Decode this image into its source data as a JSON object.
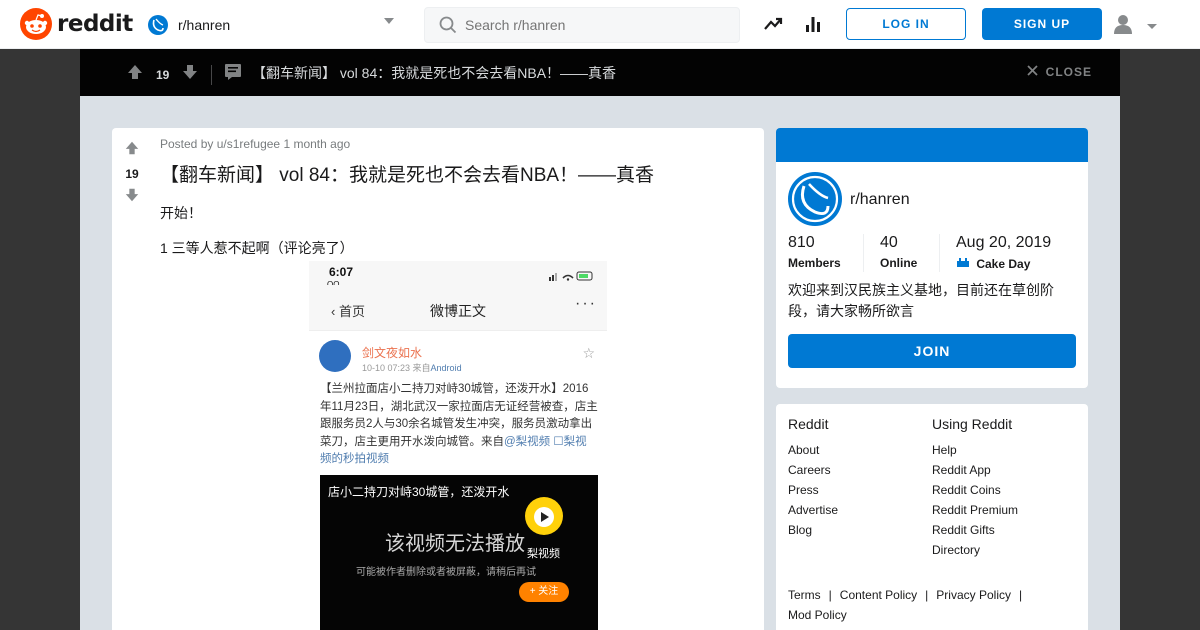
{
  "header": {
    "logo_text": "reddit",
    "subreddit": "r/hanren",
    "search_placeholder": "Search r/hanren",
    "login_label": "LOG IN",
    "signup_label": "SIGN UP"
  },
  "topbar": {
    "score": "19",
    "title": "【翻车新闻】 vol 84：我就是死也不会去看NBA！——真香",
    "close_label": "CLOSE"
  },
  "post": {
    "score": "19",
    "meta_prefix": "Posted by",
    "author": "u/s1refugee",
    "time": "1 month ago",
    "title": "【翻车新闻】 vol 84：我就是死也不会去看NBA！——真香",
    "paragraph1": "开始！",
    "paragraph2": "1 三等人惹不起啊（评论亮了）"
  },
  "screenshot": {
    "time": "6:07",
    "carrier": "QQ",
    "back_label": "首页",
    "nav_title": "微博正文",
    "more": "···",
    "username": "剑文夜如水",
    "date": "10-10 07:23  来自",
    "date_source": "Android",
    "body": "【兰州拉面店小二持刀对峙30城管，还泼开水】2016年11月23日，湖北武汉一家拉面店无证经营被查，店主跟服务员2人与30余名城管发生冲突，服务员激动拿出菜刀，店主更用开水泼向城管。来自",
    "body_link": "@梨视频 ☐梨视频的秒拍视频",
    "video_caption": "店小二持刀对峙30城管，还泼开水",
    "video_main": "该视频无法播放",
    "video_sub": "可能被作者删除或者被屏蔽，请稍后再试",
    "video_brand": "梨视频",
    "video_follow": "+ 关注"
  },
  "about": {
    "name": "r/hanren",
    "members_count": "810",
    "members_label": "Members",
    "online_count": "40",
    "online_label": "Online",
    "cake_date": "Aug 20, 2019",
    "cake_label": "Cake Day",
    "description": "欢迎来到汉民族主义基地，目前还在草创阶段，请大家畅所欲言",
    "join_label": "JOIN"
  },
  "footer_links": {
    "reddit_title": "Reddit",
    "reddit_links": [
      "About",
      "Careers",
      "Press",
      "Advertise",
      "Blog"
    ],
    "using_title": "Using Reddit",
    "using_links": [
      "Help",
      "Reddit App",
      "Reddit Coins",
      "Reddit Premium",
      "Reddit Gifts",
      "Directory"
    ],
    "legal": [
      "Terms",
      "Content Policy",
      "Privacy Policy",
      "Mod Policy"
    ]
  },
  "colors": {
    "brand": "#ff4500",
    "accent": "#0079d3",
    "topbar": "#030303"
  }
}
